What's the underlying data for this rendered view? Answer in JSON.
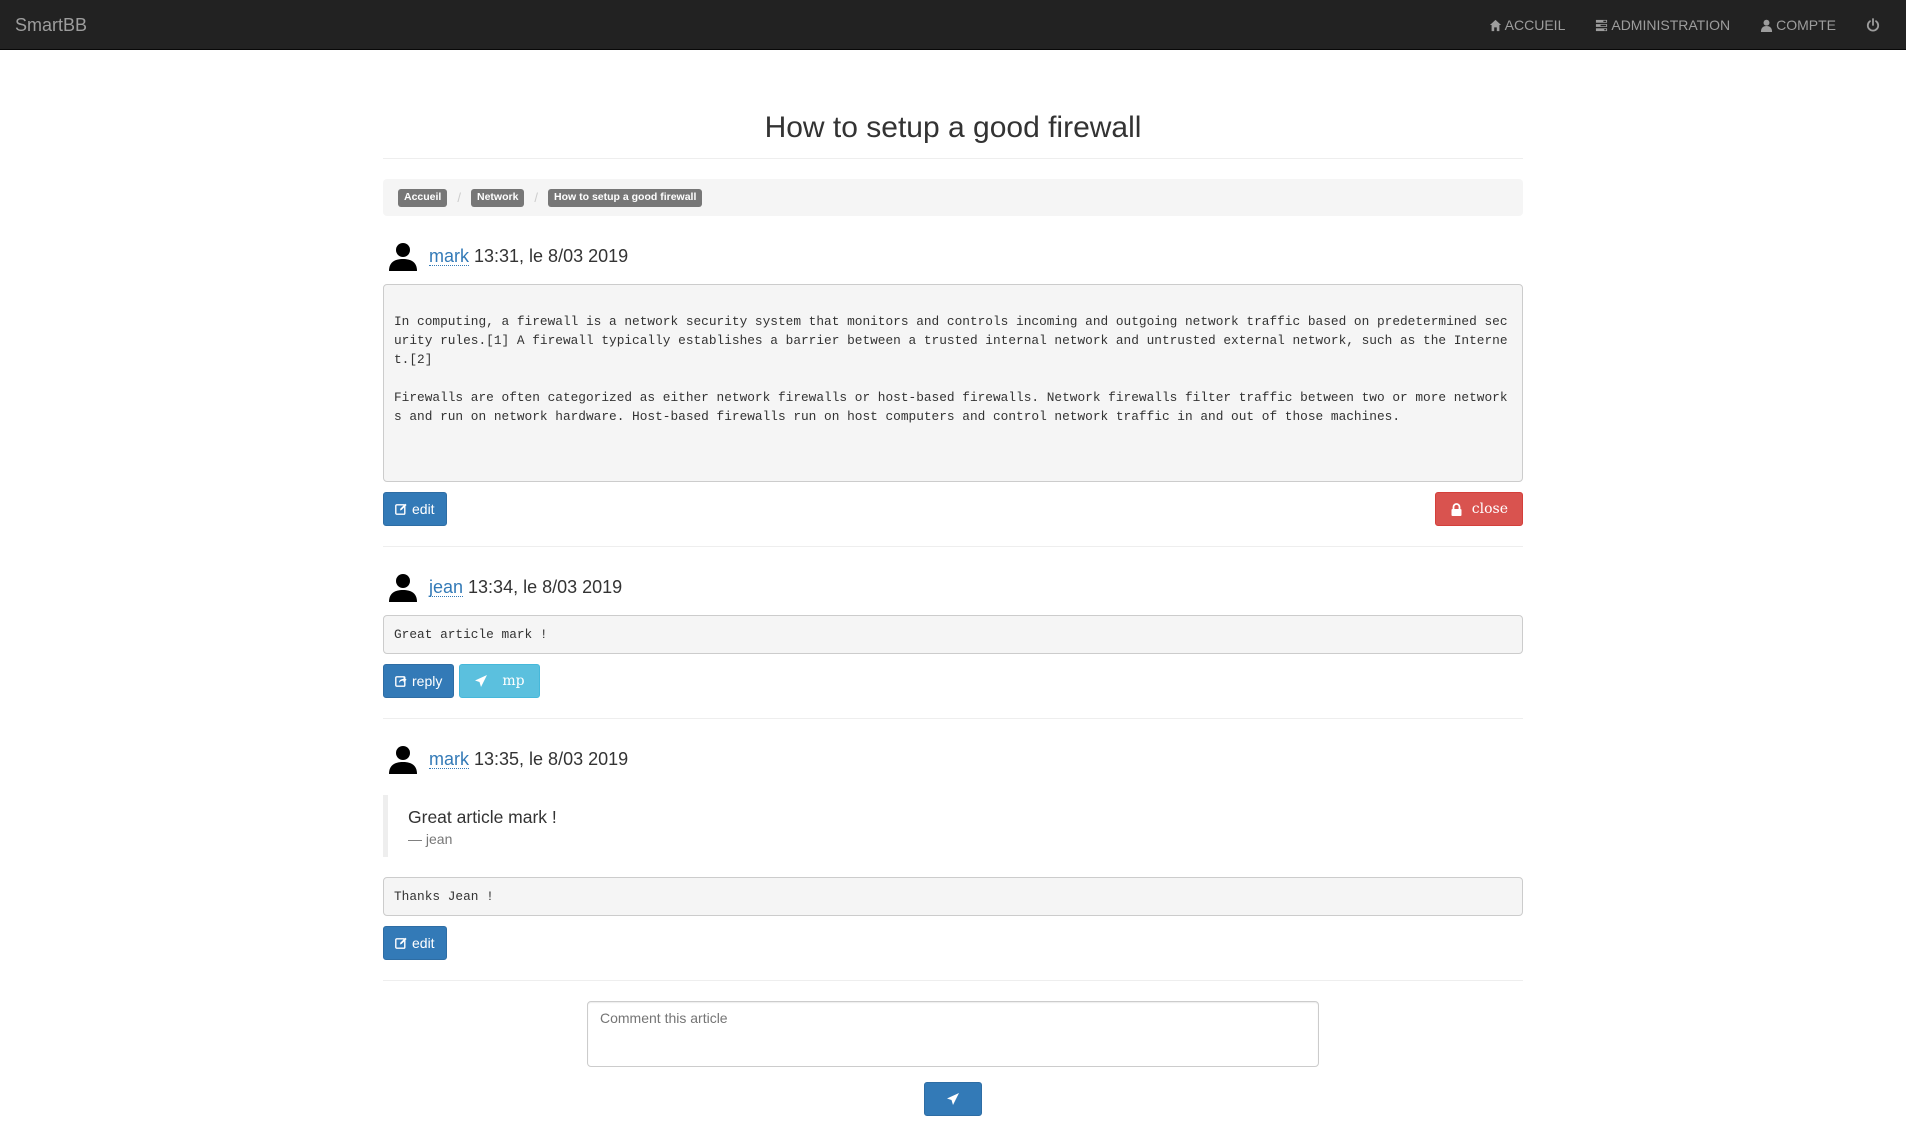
{
  "navbar": {
    "brand": "SmartBB",
    "links": [
      {
        "label": "ACCUEIL",
        "icon": "home-icon"
      },
      {
        "label": "ADMINISTRATION",
        "icon": "tasks-icon"
      },
      {
        "label": "COMPTE",
        "icon": "user-icon"
      }
    ],
    "logout_icon": "power-icon"
  },
  "page": {
    "title": "How to setup a good firewall"
  },
  "breadcrumb": [
    "Accueil",
    "Network",
    "How to setup a good firewall"
  ],
  "posts": [
    {
      "author": "mark",
      "time": "13:31, le 8/03 2019",
      "body": "In computing, a firewall is a network security system that monitors and controls incoming and outgoing network traffic based on predetermined security rules.[1] A firewall typically establishes a barrier between a trusted internal network and untrusted external network, such as the Internet.[2]\n\nFirewalls are often categorized as either network firewalls or host-based firewalls. Network firewalls filter traffic between two or more networks and run on network hardware. Host-based firewalls run on host computers and control network traffic in and out of those machines.",
      "edit_label": "edit",
      "close_label": "close"
    },
    {
      "author": "jean",
      "time": "13:34, le 8/03 2019",
      "body": "Great article mark !",
      "reply_label": "reply",
      "mp_label": "mp"
    },
    {
      "author": "mark",
      "time": "13:35, le 8/03 2019",
      "quote": {
        "text": "Great article mark !",
        "author": "— jean"
      },
      "body": "Thanks Jean !",
      "edit_label": "edit"
    }
  ],
  "comment": {
    "placeholder": "Comment this article"
  },
  "colors": {
    "navbar_bg": "#222222",
    "primary": "#337ab7",
    "danger": "#d9534f",
    "info": "#5bc0de"
  }
}
